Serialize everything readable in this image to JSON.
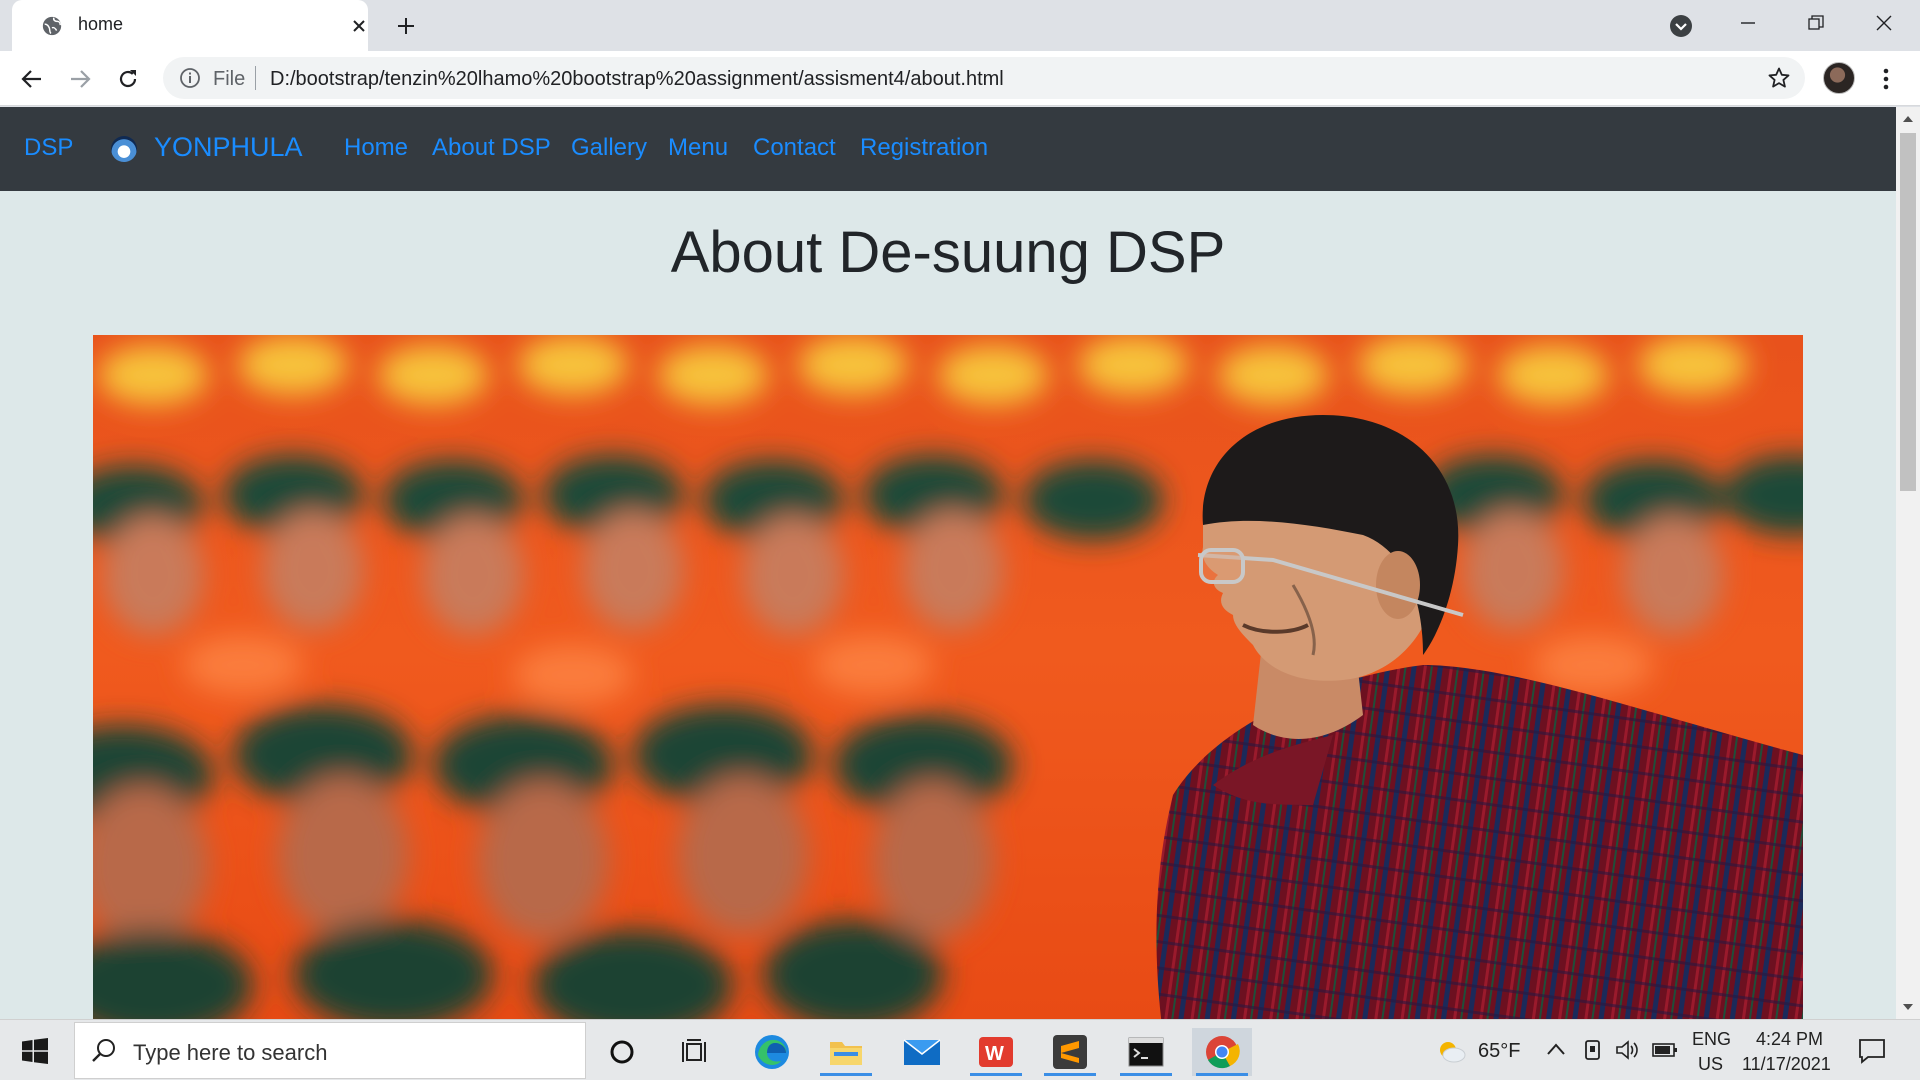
{
  "browser": {
    "tab_title": "home",
    "address_scheme": "File",
    "address_url": "D:/bootstrap/tenzin%20lhamo%20bootstrap%20assignment/assisment4/about.html"
  },
  "site": {
    "nav": {
      "brand": "DSP",
      "brand2": "YONPHULA",
      "links": [
        "Home",
        "About DSP",
        "Gallery",
        "Menu",
        "Contact",
        "Registration"
      ]
    },
    "heading": "About De-suung DSP",
    "colors": {
      "navbar": "#343a40",
      "link": "#1a8cff",
      "page_bg": "#dde8e9"
    }
  },
  "taskbar": {
    "search_placeholder": "Type here to search",
    "weather": "65°F",
    "lang_top": "ENG",
    "lang_bottom": "US",
    "time": "4:24 PM",
    "date": "11/17/2021",
    "icons": [
      "cortana-icon",
      "task-view-icon",
      "edge-icon",
      "file-explorer-icon",
      "mail-icon",
      "wps-icon",
      "sublime-icon",
      "terminal-icon",
      "chrome-icon"
    ]
  }
}
